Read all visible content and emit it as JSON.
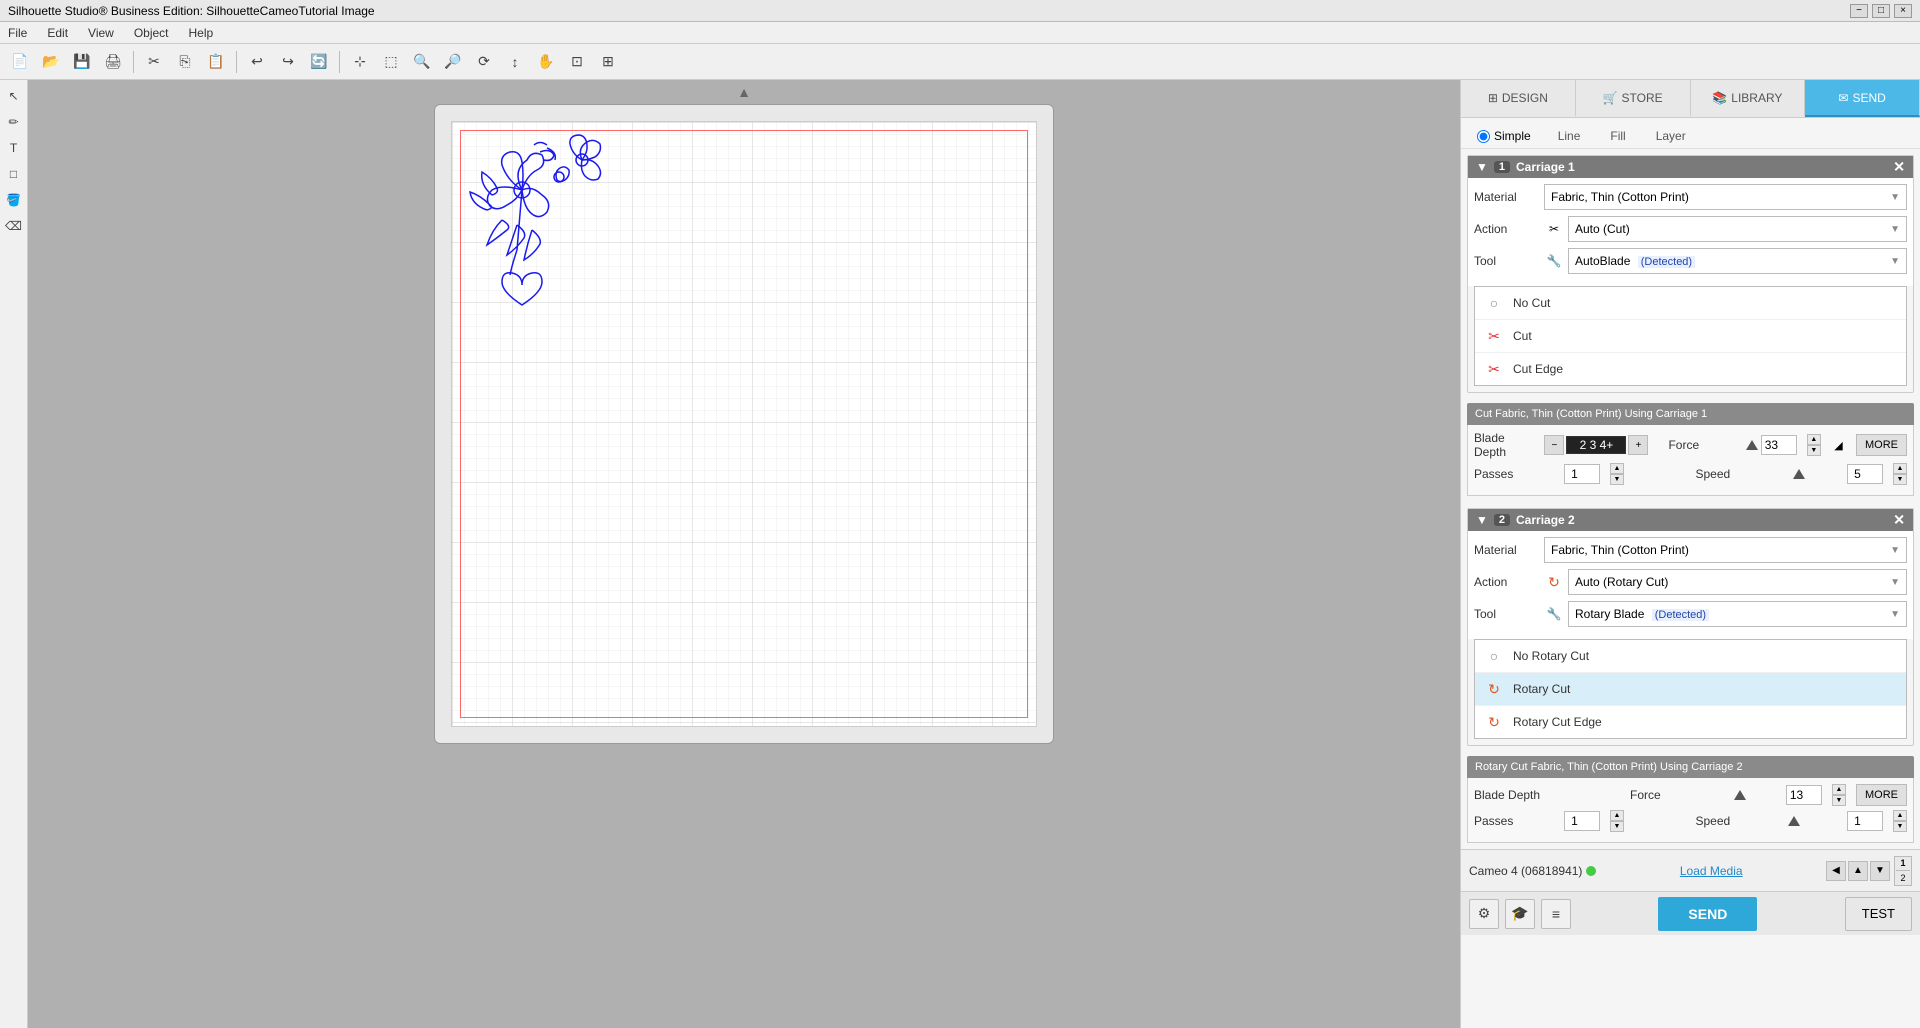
{
  "titleBar": {
    "title": "Silhouette Studio® Business Edition: SilhouetteCameoTutorial Image",
    "winBtns": [
      "−",
      "□",
      "×"
    ]
  },
  "menuBar": {
    "items": [
      "File",
      "Edit",
      "View",
      "Object",
      "Help"
    ]
  },
  "panelTabs": [
    {
      "id": "design",
      "label": "DESIGN",
      "icon": "⊞",
      "active": false
    },
    {
      "id": "store",
      "label": "STORE",
      "icon": "🏪",
      "active": false
    },
    {
      "id": "library",
      "label": "LIBRARY",
      "icon": "📚",
      "active": false
    },
    {
      "id": "send",
      "label": "SEND",
      "icon": "✉",
      "active": true
    }
  ],
  "subTabs": [
    {
      "id": "simple",
      "label": "Simple",
      "type": "radio",
      "checked": true
    },
    {
      "id": "line",
      "label": "Line",
      "type": "tab"
    },
    {
      "id": "fill",
      "label": "Fill",
      "type": "tab"
    },
    {
      "id": "layer",
      "label": "Layer",
      "type": "tab"
    }
  ],
  "carriage1": {
    "num": "1",
    "title": "Carriage 1",
    "material": {
      "label": "Material",
      "value": "Fabric, Thin (Cotton Print)"
    },
    "action": {
      "label": "Action",
      "value": "Auto (Cut)"
    },
    "tool": {
      "label": "Tool",
      "value": "AutoBlade",
      "extra": "(Detected)"
    },
    "actionOptions": [
      {
        "id": "no-cut",
        "label": "No Cut",
        "icon": "○",
        "type": "none"
      },
      {
        "id": "cut",
        "label": "Cut",
        "icon": "✂",
        "type": "cut",
        "selected": false
      },
      {
        "id": "cut-edge",
        "label": "Cut Edge",
        "icon": "✂",
        "type": "cut-edge"
      }
    ],
    "cutSettingsBar": "Cut Fabric, Thin (Cotton Print) Using Carriage 1",
    "bladeDepth": {
      "label": "Blade Depth",
      "values": "2  3  4+",
      "min": 1,
      "max": 10
    },
    "force": {
      "label": "Force",
      "value": "33",
      "sliderPos": 80
    },
    "speed": {
      "label": "Speed",
      "value": "5",
      "sliderPos": 20
    },
    "passes": {
      "label": "Passes",
      "value": "1"
    },
    "moreBtn": "MORE"
  },
  "carriage2": {
    "num": "2",
    "title": "Carriage 2",
    "material": {
      "label": "Material",
      "value": "Fabric, Thin (Cotton Print)"
    },
    "action": {
      "label": "Action",
      "value": "Auto (Rotary Cut)"
    },
    "tool": {
      "label": "Tool",
      "value": "Rotary Blade",
      "extra": "(Detected)"
    },
    "actionOptions": [
      {
        "id": "no-rotary-cut",
        "label": "No Rotary Cut",
        "icon": "○",
        "type": "none"
      },
      {
        "id": "rotary-cut",
        "label": "Rotary Cut",
        "icon": "↻",
        "type": "rotary",
        "selected": true
      },
      {
        "id": "rotary-cut-edge",
        "label": "Rotary Cut Edge",
        "icon": "↻",
        "type": "rotary-edge"
      }
    ],
    "cutSettingsBar": "Rotary Cut Fabric, Thin (Cotton Print) Using Carriage 2",
    "bladeDepth": {
      "label": "Blade Depth",
      "note": ""
    },
    "force": {
      "label": "Force",
      "value": "13",
      "sliderPos": 30
    },
    "speed": {
      "label": "Speed",
      "value": "1",
      "sliderPos": 5
    },
    "passes": {
      "label": "Passes",
      "value": "1"
    },
    "moreBtn": "MORE"
  },
  "statusBar": {
    "device": "Cameo 4 (06818941)",
    "statusDot": "green",
    "loadMedia": "Load Media"
  },
  "bottomBar": {
    "sendBtn": "SEND",
    "testBtn": "TEST"
  }
}
